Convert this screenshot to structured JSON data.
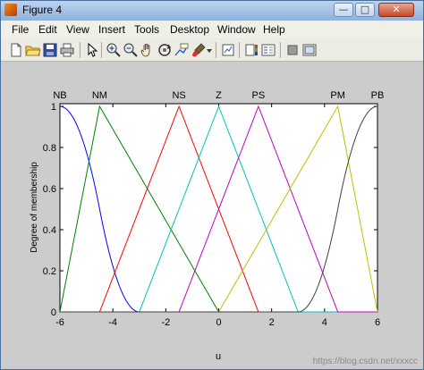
{
  "window": {
    "title": "Figure 4",
    "controls": {
      "minimize": "—",
      "maximize": "□",
      "close": "✕"
    }
  },
  "menubar": {
    "items": [
      {
        "label": "File"
      },
      {
        "label": "Edit"
      },
      {
        "label": "View"
      },
      {
        "label": "Insert"
      },
      {
        "label": "Tools"
      },
      {
        "label": "Desktop"
      },
      {
        "label": "Window"
      },
      {
        "label": "Help"
      }
    ]
  },
  "toolbar": {
    "icons": [
      "new-file-icon",
      "open-folder-icon",
      "save-icon",
      "print-icon",
      "select-arrow-icon",
      "zoom-in-icon",
      "zoom-out-icon",
      "pan-hand-icon",
      "rotate-3d-icon",
      "data-cursor-icon",
      "brush-icon",
      "brush-dropdown-icon",
      "link-icon",
      "colorbar-icon",
      "legend-icon",
      "hide-plot-tools-icon",
      "show-plot-tools-icon"
    ]
  },
  "chart_data": {
    "type": "line",
    "xlabel": "u",
    "ylabel": "Degree of membership",
    "xlim": [
      -6,
      6
    ],
    "ylim": [
      0,
      1
    ],
    "xticks": [
      "-6",
      "-4",
      "-2",
      "0",
      "2",
      "4",
      "6"
    ],
    "yticks": [
      "0",
      "0.2",
      "0.4",
      "0.6",
      "0.8",
      "1"
    ],
    "series": [
      {
        "name": "NB",
        "shape": "zmf",
        "x": [
          -6,
          -3
        ],
        "color": "#0000ff"
      },
      {
        "name": "NM",
        "shape": "trimf",
        "x": [
          -6,
          -4.5,
          0
        ],
        "color": "#008000"
      },
      {
        "name": "NS",
        "shape": "trimf",
        "x": [
          -4.5,
          -1.5,
          1.5
        ],
        "color": "#ff0000"
      },
      {
        "name": "Z",
        "shape": "trimf",
        "x": [
          -3,
          0,
          3
        ],
        "color": "#00bfbf"
      },
      {
        "name": "PS",
        "shape": "trimf",
        "x": [
          -1.5,
          1.5,
          4.5
        ],
        "color": "#bf00bf"
      },
      {
        "name": "PM",
        "shape": "trimf",
        "x": [
          0,
          4.5,
          6
        ],
        "color": "#bfbf00"
      },
      {
        "name": "PB",
        "shape": "smf",
        "x": [
          3,
          6
        ],
        "color": "#404040"
      }
    ]
  },
  "watermark": "https://blog.csdn.net/xxxcc"
}
